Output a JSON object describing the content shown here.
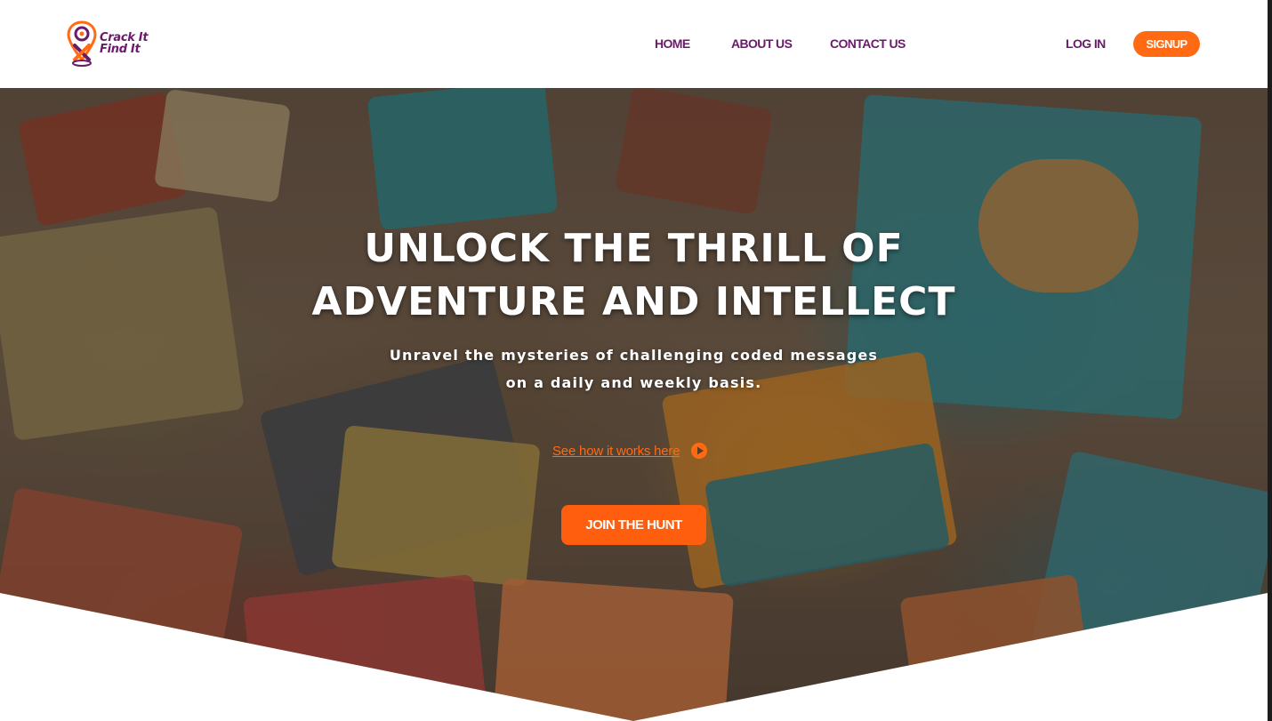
{
  "brand": {
    "logo_line1": "Crack It",
    "logo_line2": "Find It",
    "logo_icon": "map-pin-magnifier-icon",
    "primary_color": "#6b1a6b",
    "accent_color": "#ff6a13"
  },
  "nav": {
    "items": [
      {
        "label": "HOME"
      },
      {
        "label": "ABOUT US"
      },
      {
        "label": "CONTACT US"
      }
    ],
    "login_label": "LOG IN",
    "signup_label": "SIGNUP"
  },
  "hero": {
    "title_line1": "Unlock the thrill of",
    "title_line2": "adventure and intellect",
    "subtitle": "Unravel the mysteries of challenging coded messages on a daily and weekly basis.",
    "how_link_label": "See how it works here",
    "how_link_icon": "play-circle-icon",
    "cta_label": "JOIN THE HUNT",
    "background": "jigsaw-puzzle-pieces-photo"
  }
}
